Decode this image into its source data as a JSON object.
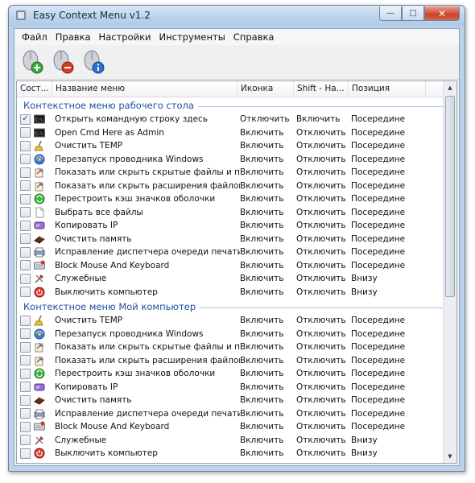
{
  "window": {
    "title": "Easy Context Menu v1.2",
    "controls": {
      "minimize": "—",
      "maximize": "□",
      "close": "✕"
    }
  },
  "menubar": [
    "Файл",
    "Правка",
    "Настройки",
    "Инструменты",
    "Справка"
  ],
  "toolbar": {
    "buttons": [
      {
        "icon": "add-mouse-icon"
      },
      {
        "icon": "remove-mouse-icon"
      },
      {
        "icon": "info-mouse-icon"
      }
    ]
  },
  "columns": [
    "Сост...",
    "Название меню",
    "Иконка",
    "Shift - На...",
    "Позиция"
  ],
  "groups": [
    {
      "title": "Контекстное меню рабочего стола",
      "rows": [
        {
          "checked": true,
          "icon": "cmd",
          "name": "Открыть командную строку здесь",
          "icon_col": "Отключить",
          "shift": "Включить",
          "pos": "Посередине"
        },
        {
          "checked": false,
          "icon": "cmd",
          "name": "Open Cmd Here as Admin",
          "icon_col": "Включить",
          "shift": "Отключить",
          "pos": "Посередине"
        },
        {
          "checked": false,
          "icon": "broom",
          "name": "Очистить TEMP",
          "icon_col": "Включить",
          "shift": "Отключить",
          "pos": "Посередине"
        },
        {
          "checked": false,
          "icon": "explorer",
          "name": "Перезапуск проводника Windows",
          "icon_col": "Включить",
          "shift": "Отключить",
          "pos": "Посередине"
        },
        {
          "checked": false,
          "icon": "files",
          "name": "Показать или скрыть скрытые файлы и папки",
          "icon_col": "Включить",
          "shift": "Отключить",
          "pos": "Посередине"
        },
        {
          "checked": false,
          "icon": "files",
          "name": "Показать или скрыть расширения файлов",
          "icon_col": "Включить",
          "shift": "Отключить",
          "pos": "Посередине"
        },
        {
          "checked": false,
          "icon": "recycle",
          "name": "Перестроить кэш значков оболочки",
          "icon_col": "Включить",
          "shift": "Отключить",
          "pos": "Посередине"
        },
        {
          "checked": false,
          "icon": "file",
          "name": "Выбрать все файлы",
          "icon_col": "Включить",
          "shift": "Отключить",
          "pos": "Посередине"
        },
        {
          "checked": false,
          "icon": "ip",
          "name": "Копировать IP",
          "icon_col": "Включить",
          "shift": "Отключить",
          "pos": "Посередине"
        },
        {
          "checked": false,
          "icon": "memory",
          "name": "Очистить память",
          "icon_col": "Включить",
          "shift": "Отключить",
          "pos": "Посередине"
        },
        {
          "checked": false,
          "icon": "printer",
          "name": "Исправление диспетчера очереди печати",
          "icon_col": "Включить",
          "shift": "Отключить",
          "pos": "Посередине"
        },
        {
          "checked": false,
          "icon": "keyboard",
          "name": "Block Mouse And Keyboard",
          "icon_col": "Включить",
          "shift": "Отключить",
          "pos": "Посередине"
        },
        {
          "checked": false,
          "icon": "tools",
          "name": "Служебные",
          "icon_col": "Включить",
          "shift": "Отключить",
          "pos": "Внизу"
        },
        {
          "checked": false,
          "icon": "power",
          "name": "Выключить компьютер",
          "icon_col": "Включить",
          "shift": "Отключить",
          "pos": "Внизу"
        }
      ]
    },
    {
      "title": "Контекстное меню Мой компьютер",
      "rows": [
        {
          "checked": false,
          "icon": "broom",
          "name": "Очистить TEMP",
          "icon_col": "Включить",
          "shift": "Отключить",
          "pos": "Посередине"
        },
        {
          "checked": false,
          "icon": "explorer",
          "name": "Перезапуск проводника Windows",
          "icon_col": "Включить",
          "shift": "Отключить",
          "pos": "Посередине"
        },
        {
          "checked": false,
          "icon": "files",
          "name": "Показать или скрыть скрытые файлы и папки",
          "icon_col": "Включить",
          "shift": "Отключить",
          "pos": "Посередине"
        },
        {
          "checked": false,
          "icon": "files",
          "name": "Показать или скрыть расширения файлов",
          "icon_col": "Включить",
          "shift": "Отключить",
          "pos": "Посередине"
        },
        {
          "checked": false,
          "icon": "recycle",
          "name": "Перестроить кэш значков оболочки",
          "icon_col": "Включить",
          "shift": "Отключить",
          "pos": "Посередине"
        },
        {
          "checked": false,
          "icon": "ip",
          "name": "Копировать IP",
          "icon_col": "Включить",
          "shift": "Отключить",
          "pos": "Посередине"
        },
        {
          "checked": false,
          "icon": "memory",
          "name": "Очистить память",
          "icon_col": "Включить",
          "shift": "Отключить",
          "pos": "Посередине"
        },
        {
          "checked": false,
          "icon": "printer",
          "name": "Исправление диспетчера очереди печати",
          "icon_col": "Включить",
          "shift": "Отключить",
          "pos": "Посередине"
        },
        {
          "checked": false,
          "icon": "keyboard",
          "name": "Block Mouse And Keyboard",
          "icon_col": "Включить",
          "shift": "Отключить",
          "pos": "Посередине"
        },
        {
          "checked": false,
          "icon": "tools",
          "name": "Служебные",
          "icon_col": "Включить",
          "shift": "Отключить",
          "pos": "Внизу"
        },
        {
          "checked": false,
          "icon": "power",
          "name": "Выключить компьютер",
          "icon_col": "Включить",
          "shift": "Отключить",
          "pos": "Внизу"
        }
      ]
    }
  ]
}
